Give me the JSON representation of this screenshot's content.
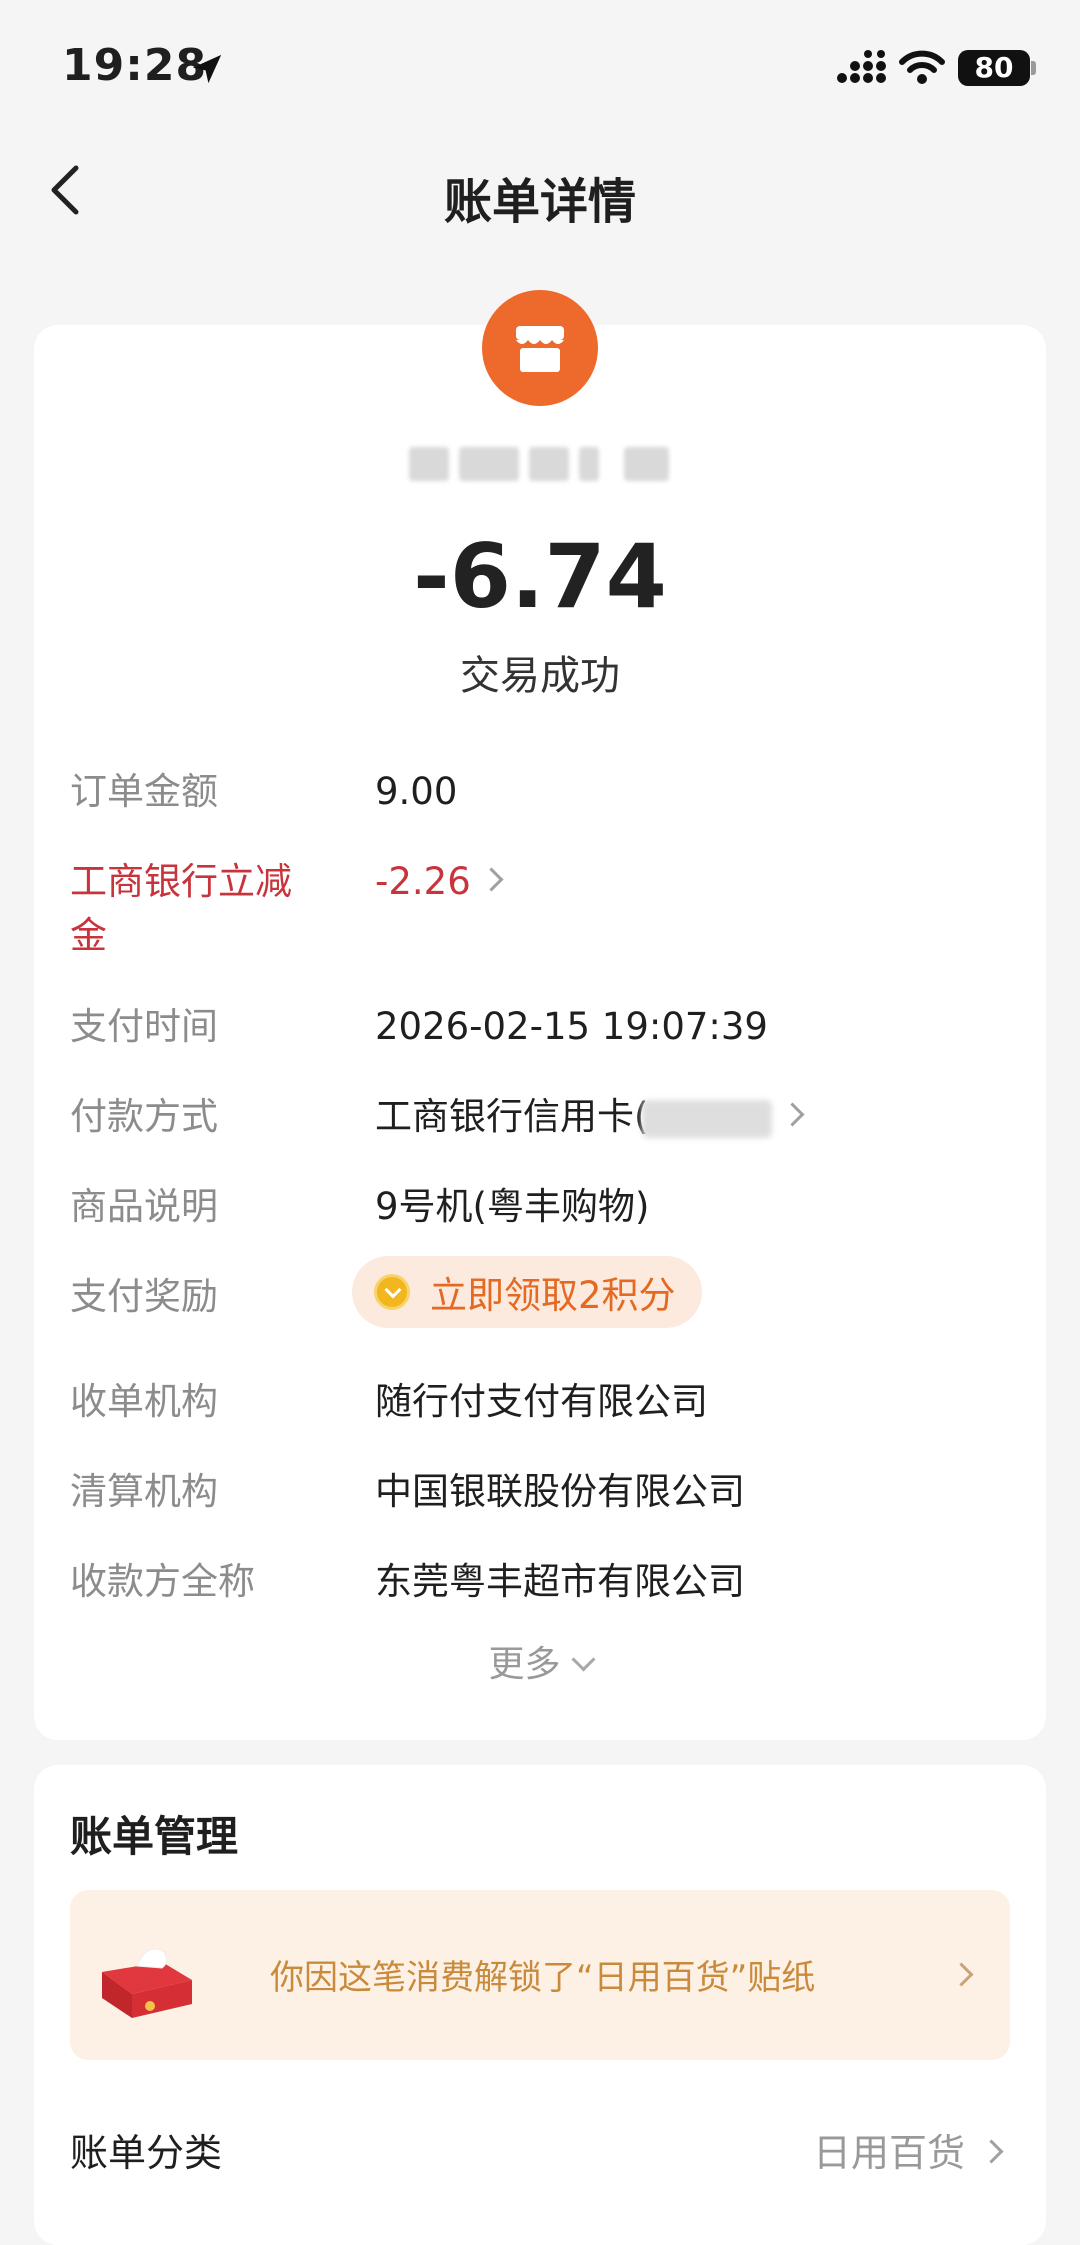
{
  "status_bar": {
    "time": "19:28",
    "battery": "80"
  },
  "nav": {
    "title": "账单详情"
  },
  "summary": {
    "amount": "-6.74",
    "status": "交易成功"
  },
  "details": [
    {
      "label": "订单金额",
      "value": "9.00"
    },
    {
      "label": "工商银行立减金",
      "value": "-2.26"
    },
    {
      "label": "支付时间",
      "value": "2026-02-15 19:07:39"
    },
    {
      "label": "付款方式",
      "value": "工商银行信用卡("
    },
    {
      "label": "商品说明",
      "value": "9号机(粤丰购物)"
    },
    {
      "label": "支付奖励",
      "value": "立即领取2积分"
    },
    {
      "label": "收单机构",
      "value": "随行付支付有限公司"
    },
    {
      "label": "清算机构",
      "value": "中国银联股份有限公司"
    },
    {
      "label": "收款方全称",
      "value": "东莞粤丰超市有限公司"
    }
  ],
  "more_label": "更多",
  "management": {
    "title": "账单管理",
    "banner_text": "你因这笔消费解锁了“日用百货”贴纸",
    "category_label": "账单分类",
    "category_value": "日用百货"
  },
  "colors": {
    "accent_orange": "#ee6a2c",
    "discount_red": "#c8343c",
    "background": "#f5f5f5"
  }
}
